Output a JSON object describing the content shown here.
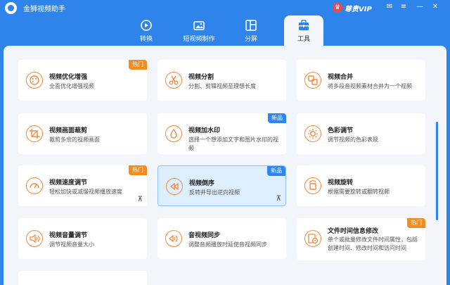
{
  "app": {
    "title": "金狮视频助手",
    "vip_label": "尊贵VIP"
  },
  "window_controls": {
    "message": "✉",
    "menu": "≡",
    "minimize": "—",
    "close": "✕"
  },
  "tabs": [
    {
      "label": "转换",
      "icon": "convert-icon"
    },
    {
      "label": "短视频制作",
      "icon": "short-video-icon"
    },
    {
      "label": "分屏",
      "icon": "split-screen-icon"
    },
    {
      "label": "工具",
      "icon": "toolbox-icon",
      "active": true
    }
  ],
  "cards": [
    {
      "title": "视频优化增强",
      "desc": "全面优化增强视频",
      "badge": "热门",
      "icon": "palette-icon"
    },
    {
      "title": "视频分割",
      "desc": "分割、剪辑视频至理想长度",
      "badge": "",
      "icon": "scissors-icon"
    },
    {
      "title": "视频合并",
      "desc": "将多段音视频素材合并为一个视频",
      "badge": "",
      "icon": "merge-icon"
    },
    {
      "title": "视频画面裁剪",
      "desc": "裁剪多余的视频画面",
      "badge": "",
      "icon": "crop-icon"
    },
    {
      "title": "视频加水印",
      "desc": "选择一个想添加文字和图片水印的视频",
      "badge": "新品",
      "icon": "drop-icon"
    },
    {
      "title": "色彩调节",
      "desc": "调节视频的色彩表现",
      "badge": "",
      "icon": "brightness-icon"
    },
    {
      "title": "视频速度调节",
      "desc": "轻松加快或减慢视频播放速度",
      "badge": "热门",
      "icon": "speedometer-icon",
      "pin": "⊼"
    },
    {
      "title": "视频倒序",
      "desc": "反转并导出逆向视频",
      "badge": "新品",
      "icon": "rewind-icon",
      "pin": "⊼",
      "selected": true
    },
    {
      "title": "视频旋转",
      "desc": "根据需要旋转或翻转视频",
      "badge": "",
      "icon": "rotate-icon"
    },
    {
      "title": "视频音量调节",
      "desc": "调节视频音量大小",
      "badge": "",
      "icon": "volume-icon"
    },
    {
      "title": "音视频同步",
      "desc": "调整音频播放时延使音视频同步",
      "badge": "",
      "icon": "sync-icon"
    },
    {
      "title": "文件时间信息修改",
      "desc": "单个或批量修改文件时间属性，包括创建时间、修改时间和访问时间",
      "badge": "热门",
      "icon": "clock-file-icon"
    }
  ]
}
